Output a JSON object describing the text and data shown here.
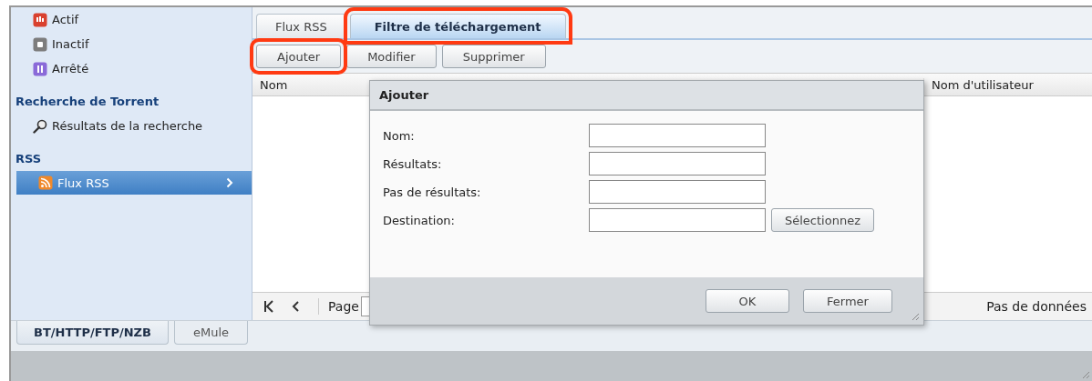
{
  "sidebar": {
    "groups": [
      {
        "items": [
          {
            "label": "Actif",
            "kind": "active",
            "selected": false
          },
          {
            "label": "Inactif",
            "kind": "inactive",
            "selected": false
          },
          {
            "label": "Arrêté",
            "kind": "stopped",
            "selected": false
          }
        ]
      },
      {
        "title": "Recherche de Torrent",
        "items": [
          {
            "label": "Résultats de la recherche",
            "kind": "search",
            "selected": false
          }
        ]
      },
      {
        "title": "RSS",
        "items": [
          {
            "label": "Flux RSS",
            "kind": "rss",
            "selected": true
          }
        ]
      }
    ]
  },
  "tabs": [
    {
      "label": "Flux RSS",
      "selected": false,
      "highlighted": false
    },
    {
      "label": "Filtre de téléchargement",
      "selected": true,
      "highlighted": true
    }
  ],
  "toolbar": [
    {
      "label": "Ajouter",
      "highlighted": true
    },
    {
      "label": "Modifier",
      "highlighted": false
    },
    {
      "label": "Supprimer",
      "highlighted": false
    }
  ],
  "table": {
    "columns": [
      "Nom",
      "Nom d'utilisateur"
    ]
  },
  "pager": {
    "label": "Page",
    "status": "Pas de données"
  },
  "bottom_tabs": [
    {
      "label": "BT/HTTP/FTP/NZB",
      "selected": true
    },
    {
      "label": "eMule",
      "selected": false
    }
  ],
  "dialog": {
    "title": "Ajouter",
    "fields": [
      {
        "label": "Nom:"
      },
      {
        "label": "Résultats:"
      },
      {
        "label": "Pas de résultats:"
      },
      {
        "label": "Destination:",
        "button": "Sélectionnez"
      }
    ],
    "buttons": [
      "OK",
      "Fermer"
    ]
  }
}
